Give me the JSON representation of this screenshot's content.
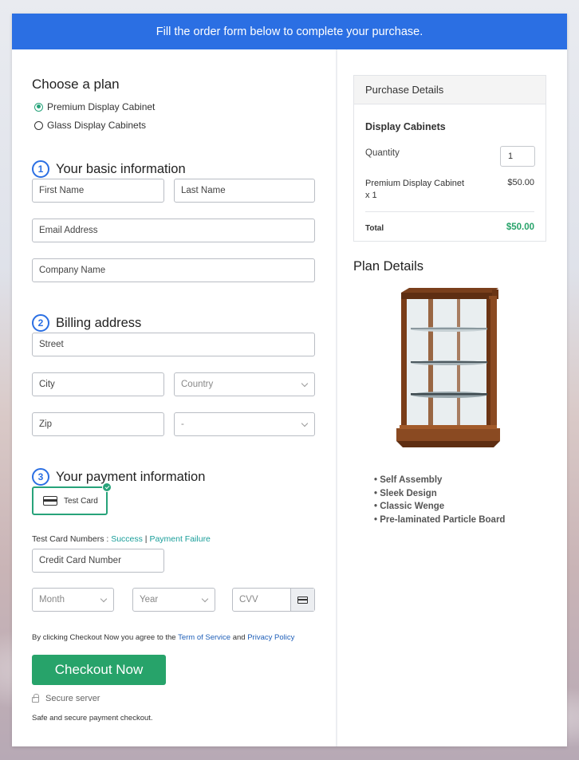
{
  "banner": {
    "text": "Fill the order form below to complete your purchase."
  },
  "plan": {
    "heading": "Choose a plan",
    "options": [
      {
        "label": "Premium Display Cabinet",
        "selected": true
      },
      {
        "label": "Glass Display Cabinets",
        "selected": false
      }
    ]
  },
  "basic_info": {
    "number": "1",
    "title": "Your basic information",
    "first_name_placeholder": "First Name",
    "last_name_placeholder": "Last Name",
    "email_placeholder": "Email Address",
    "company_placeholder": "Company Name"
  },
  "billing": {
    "number": "2",
    "title": "Billing address",
    "street_placeholder": "Street",
    "city_placeholder": "City",
    "country_placeholder": "Country",
    "zip_placeholder": "Zip",
    "state_placeholder": "-"
  },
  "payment": {
    "number": "3",
    "title": "Your payment information",
    "card_option": "Test Card",
    "test_numbers_label": "Test Card Numbers : ",
    "success_link": "Success",
    "separator": " | ",
    "failure_link": "Payment Failure",
    "card_number_placeholder": "Credit Card Number",
    "month_placeholder": "Month",
    "year_placeholder": "Year",
    "cvv_placeholder": "CVV"
  },
  "terms": {
    "prefix": "By clicking Checkout Now you agree to the ",
    "tos_link": "Term of Service",
    "and": " and ",
    "privacy_link": "Privacy Policy"
  },
  "checkout": {
    "button": "Checkout Now",
    "secure": "Secure server",
    "safe": "Safe and secure payment checkout."
  },
  "purchase": {
    "heading": "Purchase Details",
    "product": "Display Cabinets",
    "quantity_label": "Quantity",
    "quantity": "1",
    "item_name": "Premium Display Cabinet",
    "item_qty": "x 1",
    "item_price": "$50.00",
    "total_label": "Total",
    "total": "$50.00"
  },
  "plan_details": {
    "heading": "Plan Details",
    "features": [
      "Self Assembly",
      "Sleek Design",
      "Classic Wenge",
      "Pre-laminated Particle Board"
    ]
  },
  "colors": {
    "accent": "#2b6fe3",
    "success": "#27a36a",
    "link": "#1a9e9a"
  }
}
